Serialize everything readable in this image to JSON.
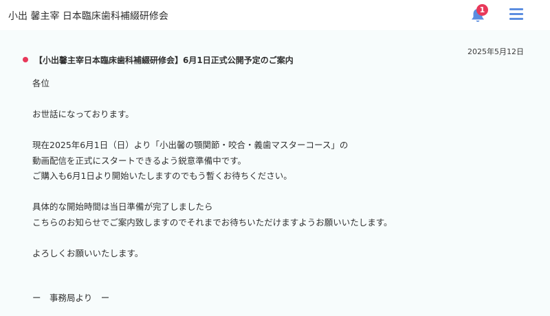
{
  "header": {
    "title": "小出 馨主宰 日本臨床歯科補綴研修会",
    "notification_count": "1",
    "accent_color": "#5b8de0",
    "badge_color": "#e8395a"
  },
  "post": {
    "date": "2025年5月12日",
    "title": "【小出馨主宰日本臨床歯科補綴研修会】6月1日正式公開予定のご案内",
    "lines": [
      "各位",
      "",
      "お世話になっております。",
      "",
      "現在2025年6月1日（日）より「小出馨の顎関節・咬合・義歯マスターコース」の",
      "動画配信を正式にスタートできるよう鋭意準備中です。",
      "ご購入も6月1日より開始いたしますのでもう暫くお待ちください。",
      "",
      "具体的な開始時間は当日準備が完了しましたら",
      "こちらのお知らせでご案内致しますのでそれまでお待ちいただけますようお願いいたします。",
      "",
      "よろしくお願いいたします。"
    ],
    "signoff": "ー　事務局より　ー"
  }
}
